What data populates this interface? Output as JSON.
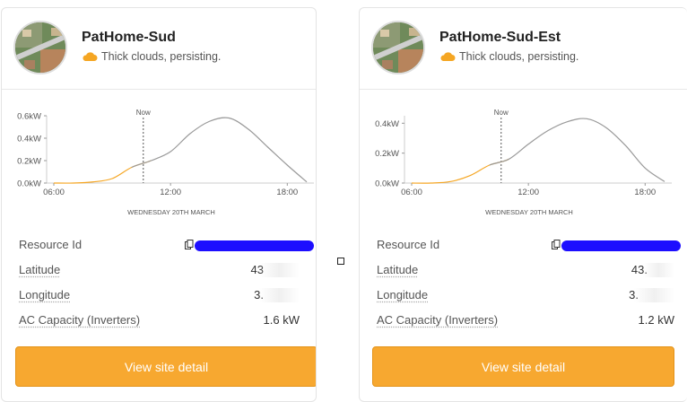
{
  "cards": [
    {
      "name": "PatHome-Sud",
      "weather": "Thick clouds, persisting.",
      "chart_data": {
        "type": "area",
        "x": [
          "06:00",
          "07:00",
          "08:00",
          "09:00",
          "10:00",
          "11:00",
          "12:00",
          "13:00",
          "14:00",
          "15:00",
          "16:00",
          "17:00",
          "18:00",
          "19:00"
        ],
        "y": [
          0.0,
          0.0,
          0.01,
          0.04,
          0.14,
          0.2,
          0.28,
          0.44,
          0.55,
          0.58,
          0.48,
          0.32,
          0.16,
          0.01
        ],
        "ylim": [
          0,
          0.6
        ],
        "yticks": [
          "0.0kW",
          "0.2kW",
          "0.4kW",
          "0.6kW"
        ],
        "xticks": [
          "06:00",
          "12:00",
          "18:00"
        ],
        "xlabel": "WEDNESDAY 20TH MARCH",
        "marker_label": "Now",
        "past_color": "#f5a623",
        "future_color": "#999999"
      },
      "fields": {
        "resource_label": "Resource Id",
        "latitude_label": "Latitude",
        "latitude_value": "43",
        "longitude_label": "Longitude",
        "longitude_value": "3.",
        "capacity_label": "AC Capacity (Inverters)",
        "capacity_value": "1.6 kW"
      },
      "button": "View site detail"
    },
    {
      "name": "PatHome-Sud-Est",
      "weather": "Thick clouds, persisting.",
      "chart_data": {
        "type": "area",
        "x": [
          "06:00",
          "07:00",
          "08:00",
          "09:00",
          "10:00",
          "11:00",
          "12:00",
          "13:00",
          "14:00",
          "15:00",
          "16:00",
          "17:00",
          "18:00",
          "19:00"
        ],
        "y": [
          0.0,
          0.0,
          0.01,
          0.05,
          0.12,
          0.16,
          0.26,
          0.35,
          0.41,
          0.43,
          0.37,
          0.25,
          0.1,
          0.01
        ],
        "ylim": [
          0,
          0.45
        ],
        "yticks": [
          "0.0kW",
          "0.2kW",
          "0.4kW"
        ],
        "xticks": [
          "06:00",
          "12:00",
          "18:00"
        ],
        "xlabel": "WEDNESDAY 20TH MARCH",
        "marker_label": "Now",
        "past_color": "#f5a623",
        "future_color": "#999999"
      },
      "fields": {
        "resource_label": "Resource Id",
        "latitude_label": "Latitude",
        "latitude_value": "43.",
        "longitude_label": "Longitude",
        "longitude_value": "3.",
        "capacity_label": "AC Capacity (Inverters)",
        "capacity_value": "1.2 kW"
      },
      "button": "View site detail"
    }
  ],
  "icons": {
    "weather": "cloud-icon",
    "copy": "copy-icon"
  },
  "colors": {
    "accent": "#f7a830",
    "redaction": "#1d0eff"
  }
}
